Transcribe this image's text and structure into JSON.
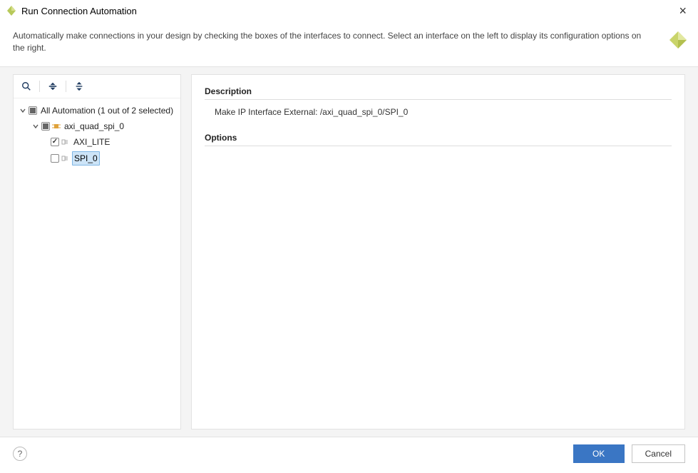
{
  "window": {
    "title": "Run Connection Automation"
  },
  "banner": {
    "text": "Automatically make connections in your design by checking the boxes of the interfaces to connect. Select an interface on the left to display its configuration options on the right."
  },
  "tree": {
    "root": {
      "label": "All Automation (1 out of 2 selected)",
      "state": "partial",
      "expanded": true
    },
    "ip": {
      "label": "axi_quad_spi_0",
      "state": "partial",
      "expanded": true
    },
    "leaf_axi": {
      "label": "AXI_LITE",
      "state": "checked",
      "selected": false
    },
    "leaf_spi": {
      "label": "SPI_0",
      "state": "unchecked",
      "selected": true
    }
  },
  "details": {
    "description_header": "Description",
    "description_text": "Make IP Interface External: /axi_quad_spi_0/SPI_0",
    "options_header": "Options"
  },
  "footer": {
    "ok_label": "OK",
    "cancel_label": "Cancel",
    "help_tooltip": "Help"
  }
}
